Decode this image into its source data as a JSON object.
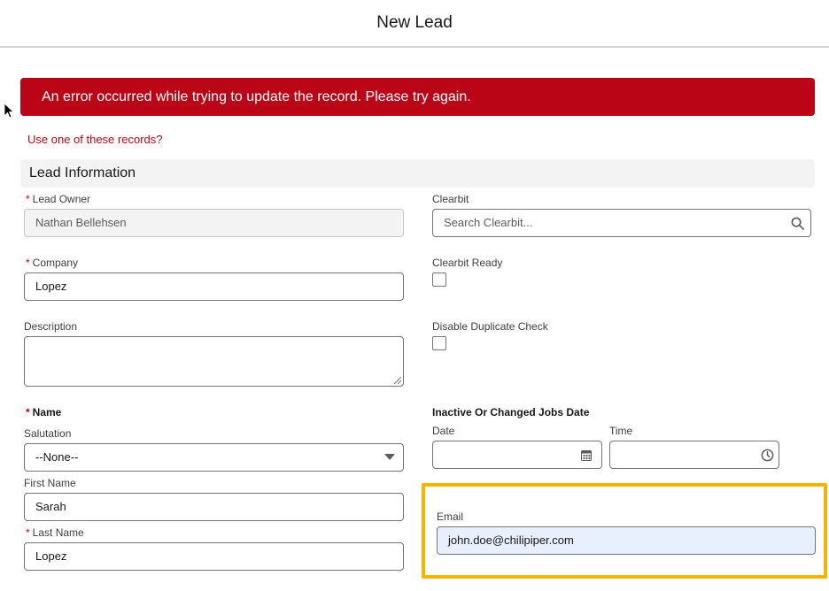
{
  "header": {
    "title": "New Lead"
  },
  "error": {
    "message": "An error occurred while trying to update the record. Please try again.",
    "link": "Use one of these records?"
  },
  "section": {
    "title": "Lead Information"
  },
  "required_marker": "*",
  "left": {
    "lead_owner": {
      "label": "Lead Owner",
      "value": "Nathan Bellehsen"
    },
    "company": {
      "label": "Company",
      "value": "Lopez"
    },
    "description": {
      "label": "Description",
      "value": ""
    },
    "name": {
      "label": "Name"
    },
    "salutation": {
      "label": "Salutation",
      "value": "--None--"
    },
    "first_name": {
      "label": "First Name",
      "value": "Sarah"
    },
    "last_name": {
      "label": "Last Name",
      "value": "Lopez"
    }
  },
  "right": {
    "clearbit": {
      "label": "Clearbit",
      "placeholder": "Search Clearbit..."
    },
    "clearbit_ready": {
      "label": "Clearbit Ready",
      "checked": false
    },
    "disable_dup": {
      "label": "Disable Duplicate Check",
      "checked": false
    },
    "inactive_jobs": {
      "label": "Inactive Or Changed Jobs Date"
    },
    "date": {
      "label": "Date",
      "value": ""
    },
    "time": {
      "label": "Time",
      "value": ""
    },
    "email": {
      "label": "Email",
      "value": "john.doe@chilipiper.com"
    }
  },
  "colors": {
    "error_red": "#ba0517",
    "highlight": "#f4b400",
    "email_fill": "#e8f0fe"
  },
  "icons": [
    "cursor-icon",
    "search-icon",
    "calendar-icon",
    "clock-icon",
    "chevron-down-icon"
  ]
}
